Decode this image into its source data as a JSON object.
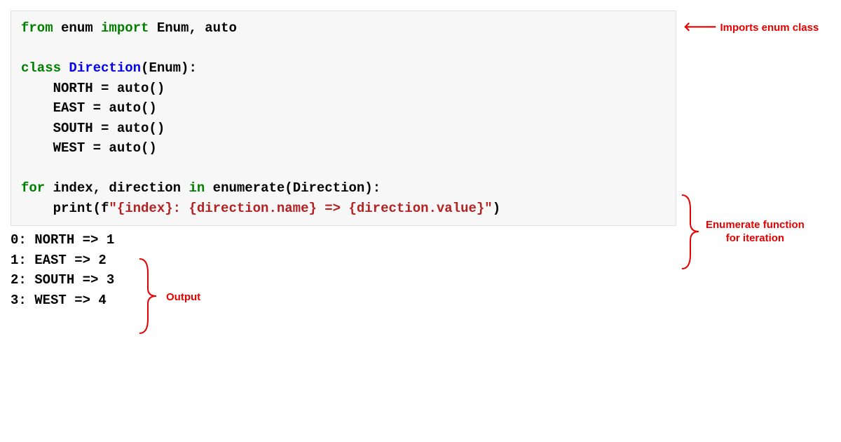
{
  "code": {
    "l1_from": "from",
    "l1_mod": " enum ",
    "l1_import": "import",
    "l1_rest": " Enum, auto",
    "l3_class": "class",
    "l3_name": " Direction",
    "l3_paren": "(Enum):",
    "l4": "    NORTH = auto()",
    "l5": "    EAST = auto()",
    "l6": "    SOUTH = auto()",
    "l7": "    WEST = auto()",
    "l9_for": "for",
    "l9_mid": " index, direction ",
    "l9_in": "in",
    "l9_enum": " enumerate",
    "l9_end": "(Direction):",
    "l10_indent": "    print(f",
    "l10_str": "\"{index}: {direction.name} => {direction.value}\"",
    "l10_end": ")"
  },
  "output": {
    "o1": "0: NORTH => 1",
    "o2": "1: EAST => 2",
    "o3": "2: SOUTH => 3",
    "o4": "3: WEST => 4"
  },
  "annotations": {
    "imports_arrow": "🡐",
    "imports": " Imports enum class",
    "enumerate_l1": "Enumerate function",
    "enumerate_l2": "for iteration",
    "output": "Output"
  }
}
